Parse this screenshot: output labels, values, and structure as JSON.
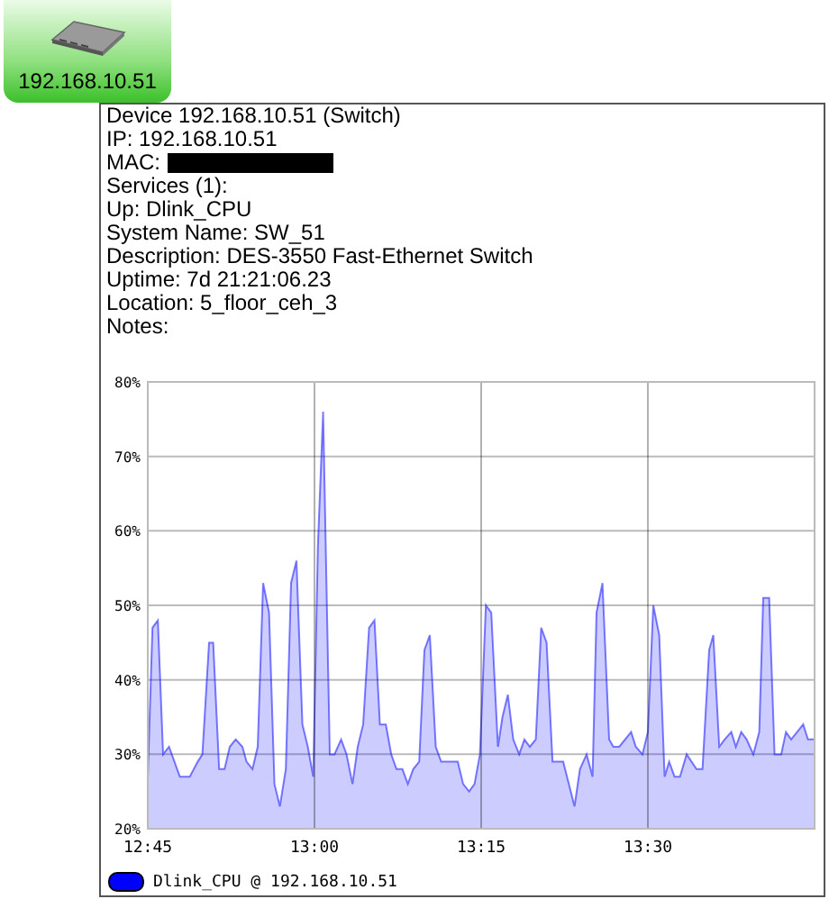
{
  "node": {
    "label": "192.168.10.51",
    "selected": true
  },
  "tooltip": {
    "lines": [
      {
        "kind": "text",
        "text": "Device 192.168.10.51 (Switch)"
      },
      {
        "kind": "text",
        "text": "IP: 192.168.10.51"
      },
      {
        "kind": "redacted",
        "text": "MAC:"
      },
      {
        "kind": "text",
        "text": "Services (1):"
      },
      {
        "kind": "text",
        "text": "Up: Dlink_CPU"
      },
      {
        "kind": "text",
        "text": "System Name: SW_51"
      },
      {
        "kind": "text",
        "text": "Description: DES-3550 Fast-Ethernet Switch"
      },
      {
        "kind": "text",
        "text": "Uptime: 7d 21:21:06.23"
      },
      {
        "kind": "text",
        "text": "Location: 5_floor_ceh_3"
      },
      {
        "kind": "text",
        "text": "Notes:"
      }
    ],
    "chart_data": {
      "type": "area",
      "grid": true,
      "xlim": [
        12.75,
        13.75
      ],
      "ylim": [
        20,
        80
      ],
      "xticks": [
        {
          "value": 12.75,
          "label": "12:45"
        },
        {
          "value": 13,
          "label": "13:00"
        },
        {
          "value": 13.25,
          "label": "13:15"
        },
        {
          "value": 13.5,
          "label": "13:30"
        }
      ],
      "yticks": [
        {
          "value": 20,
          "label": "20%"
        },
        {
          "value": 30,
          "label": "30%"
        },
        {
          "value": 40,
          "label": "40%"
        },
        {
          "value": 50,
          "label": "50%"
        },
        {
          "value": 60,
          "label": "60%"
        },
        {
          "value": 70,
          "label": "70%"
        },
        {
          "value": 80,
          "label": "80%"
        }
      ],
      "x": [
        12.75,
        12.757,
        12.765,
        12.773,
        12.782,
        12.798,
        12.813,
        12.825,
        12.832,
        12.842,
        12.848,
        12.857,
        12.865,
        12.873,
        12.882,
        12.892,
        12.898,
        12.907,
        12.915,
        12.923,
        12.932,
        12.94,
        12.948,
        12.957,
        12.965,
        12.973,
        12.982,
        12.99,
        12.998,
        13.005,
        13.013,
        13.023,
        13.03,
        13.04,
        13.048,
        13.057,
        13.065,
        13.073,
        13.082,
        13.09,
        13.098,
        13.107,
        13.115,
        13.123,
        13.132,
        13.14,
        13.148,
        13.157,
        13.165,
        13.173,
        13.182,
        13.19,
        13.198,
        13.215,
        13.223,
        13.232,
        13.24,
        13.248,
        13.257,
        13.265,
        13.275,
        13.282,
        13.29,
        13.298,
        13.307,
        13.315,
        13.323,
        13.332,
        13.34,
        13.348,
        13.357,
        13.373,
        13.39,
        13.398,
        13.408,
        13.417,
        13.423,
        13.432,
        13.442,
        13.448,
        13.457,
        13.475,
        13.482,
        13.492,
        13.5,
        13.508,
        13.517,
        13.525,
        13.532,
        13.54,
        13.548,
        13.558,
        13.573,
        13.582,
        13.592,
        13.598,
        13.607,
        13.615,
        13.625,
        13.632,
        13.64,
        13.648,
        13.658,
        13.667,
        13.673,
        13.682,
        13.69,
        13.7,
        13.707,
        13.715,
        13.733,
        13.74,
        13.75
      ],
      "series": [
        {
          "name": "Dlink_CPU @ 192.168.10.51",
          "color": "#0000ff",
          "values": [
            27,
            47,
            48,
            30,
            31,
            27,
            27,
            29,
            30,
            45,
            45,
            28,
            28,
            31,
            32,
            31,
            29,
            28,
            31,
            53,
            49,
            26,
            23,
            28,
            53,
            56,
            34,
            31,
            27,
            58,
            76,
            30,
            30,
            32,
            30,
            26,
            31,
            34,
            47,
            48,
            34,
            34,
            30,
            28,
            28,
            26,
            28,
            29,
            44,
            46,
            31,
            29,
            29,
            29,
            26,
            25,
            26,
            30,
            50,
            49,
            31,
            35,
            38,
            32,
            30,
            32,
            31,
            32,
            47,
            45,
            29,
            29,
            23,
            28,
            30,
            27,
            49,
            53,
            32,
            31,
            31,
            33,
            31,
            30,
            33,
            50,
            46,
            27,
            29,
            27,
            27,
            30,
            28,
            28,
            44,
            46,
            31,
            32,
            33,
            31,
            33,
            32,
            30,
            33,
            51,
            51,
            30,
            30,
            33,
            32,
            34,
            32,
            32
          ]
        }
      ]
    }
  }
}
